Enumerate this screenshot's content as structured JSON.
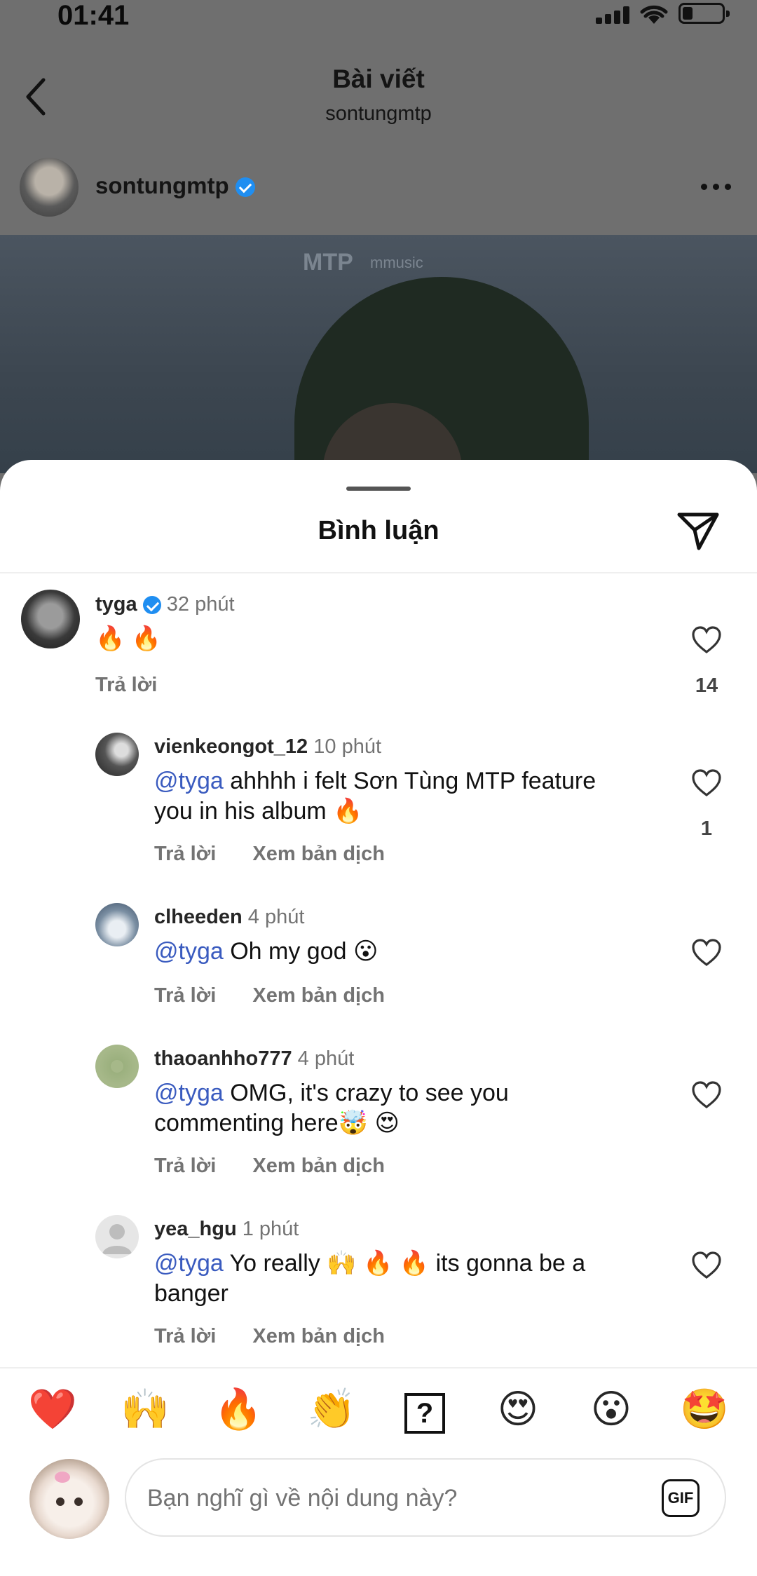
{
  "status_bar": {
    "time": "01:41"
  },
  "header": {
    "title": "Bài viết",
    "subtitle": "sontungmtp"
  },
  "post": {
    "author": "sontungmtp",
    "watermark_1": "MTP",
    "watermark_2": "mmusic"
  },
  "sheet": {
    "title": "Bình luận"
  },
  "comments": [
    {
      "user": "tyga",
      "time": "32 phút",
      "verified": true,
      "text": "🔥 🔥",
      "likes": "14",
      "reply": "Trả lời"
    },
    {
      "user": "vienkeongot_12",
      "time": "10 phút",
      "mention": "@tyga",
      "line1": "ahhhh i felt Sơn Tùng MTP feature",
      "line2": "you in his album 🔥",
      "likes": "1",
      "reply": "Trả lời",
      "translate": "Xem bản dịch"
    },
    {
      "user": "clheeden",
      "time": "4 phút",
      "mention": "@tyga",
      "line1": "Oh my god 😮",
      "reply": "Trả lời",
      "translate": "Xem bản dịch"
    },
    {
      "user": "thaoanhho777",
      "time": "4 phút",
      "mention": "@tyga",
      "line1": "OMG, it's crazy to see you",
      "line2": "commenting here🤯 😍",
      "reply": "Trả lời",
      "translate": "Xem bản dịch"
    },
    {
      "user": "yea_hgu",
      "time": "1 phút",
      "mention": "@tyga",
      "line1": "Yo really 🙌 🔥 🔥  its gonna be a",
      "line2": "banger",
      "reply": "Trả lời",
      "translate": "Xem bản dịch"
    }
  ],
  "quick_emojis": [
    "❤️",
    "🙌",
    "🔥",
    "👏",
    "?",
    "😍",
    "😮",
    "🤩"
  ],
  "composer": {
    "placeholder": "Bạn nghĩ gì về nội dung này?",
    "gif_label": "GIF"
  },
  "icons": {
    "back": "chevron-left-icon",
    "more": "more-horizontal-icon",
    "send": "send-icon",
    "heart": "heart-outline-icon",
    "verified": "verified-badge-icon"
  }
}
